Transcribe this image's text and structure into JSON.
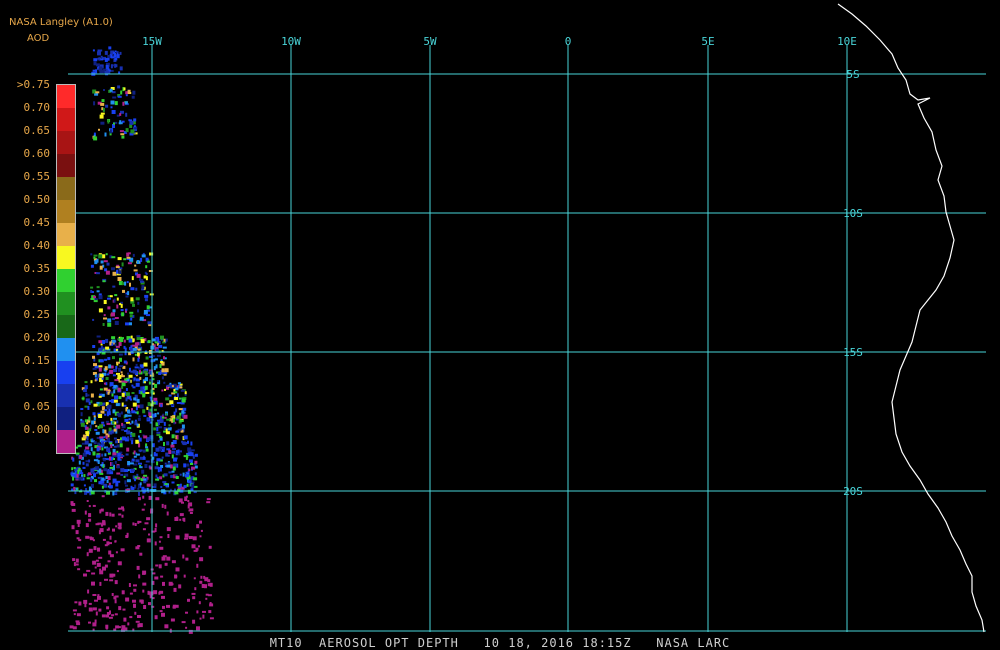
{
  "header": {
    "title": "NASA Langley (A1.0)",
    "subtitle": "AOD"
  },
  "legend": {
    "labels": [
      ">0.75",
      "0.70",
      "0.65",
      "0.60",
      "0.55",
      "0.50",
      "0.45",
      "0.40",
      "0.35",
      "0.30",
      "0.25",
      "0.20",
      "0.15",
      "0.10",
      "0.05",
      "0.00"
    ],
    "colors": [
      "#ff2a2a",
      "#d01818",
      "#a81414",
      "#7a1010",
      "#8a6a1a",
      "#b08020",
      "#e8b04a",
      "#f8f820",
      "#30d030",
      "#209020",
      "#186818",
      "#2090f0",
      "#1840f0",
      "#1830b0",
      "#102080",
      "#b0208a"
    ]
  },
  "map": {
    "longitude_labels": [
      "15W",
      "10W",
      "5W",
      "0",
      "5E",
      "10E"
    ],
    "latitude_labels": [
      "5S",
      "10S",
      "15S",
      "20S"
    ],
    "grid_color": "#49d4d8",
    "coastline_color": "#ffffff"
  },
  "footer": {
    "text": "MT10  AEROSOL OPT DEPTH   10 18, 2016 18:15Z   NASA LARC"
  }
}
